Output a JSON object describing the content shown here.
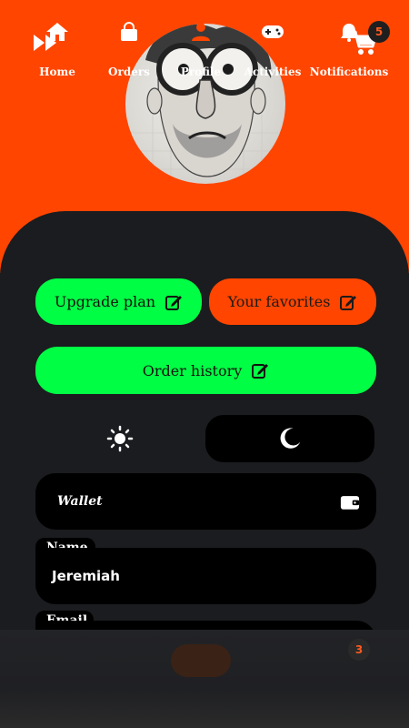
{
  "header": {
    "cart_badge": "5",
    "icons": {
      "left": "fast-forward-icon",
      "cart": "cart-icon"
    }
  },
  "profile": {
    "avatar_alt": "cartoon-face-avatar"
  },
  "actions": {
    "upgrade_label": "Upgrade plan",
    "favorites_label": "Your favorites",
    "history_label": "Order history",
    "edit_icon": "edit-icon"
  },
  "theme": {
    "light_icon": "sun-icon",
    "dark_icon": "moon-icon",
    "selected": "dark"
  },
  "wallet": {
    "label": "Wallet",
    "icon": "wallet-icon"
  },
  "fields": {
    "name_label": "Name",
    "name_value": "Jeremiah",
    "email_label": "Email"
  },
  "nav": {
    "items": [
      {
        "label": "Home",
        "icon": "home-icon"
      },
      {
        "label": "Orders",
        "icon": "shopping-bag-icon"
      },
      {
        "label": "Profile",
        "icon": "user-icon"
      },
      {
        "label": "Activities",
        "icon": "gamepad-icon"
      },
      {
        "label": "Notifications",
        "icon": "bell-icon"
      }
    ],
    "active": "Profile",
    "notifications_badge": "3"
  },
  "colors": {
    "accent_orange": "#ff4500",
    "accent_green": "#00ff44",
    "panel_dark": "#1b1c1f"
  }
}
